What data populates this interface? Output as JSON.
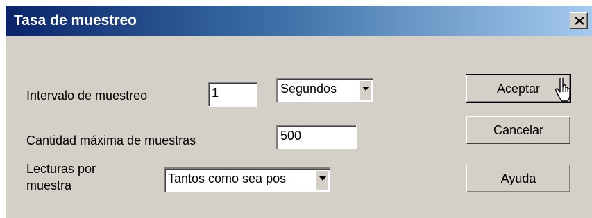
{
  "dialog": {
    "title": "Tasa de muestreo",
    "close_icon": "close-icon"
  },
  "fields": {
    "interval": {
      "label": "Intervalo de muestreo",
      "value": "1",
      "unit_value": "Segundos"
    },
    "max_samples": {
      "label": "Cantidad máxima de muestras",
      "value": "500"
    },
    "readings": {
      "label_line1": "Lecturas por",
      "label_line2": "muestra",
      "value": "Tantos como sea pos"
    }
  },
  "buttons": {
    "ok": "Aceptar",
    "cancel": "Cancelar",
    "help": "Ayuda"
  },
  "colors": {
    "title_start": "#0a246a",
    "title_end": "#a6caf0",
    "face": "#d4d0c8"
  },
  "icons": {
    "dropdown": "chevron-down-icon",
    "cursor": "mouse-pointer-icon"
  }
}
